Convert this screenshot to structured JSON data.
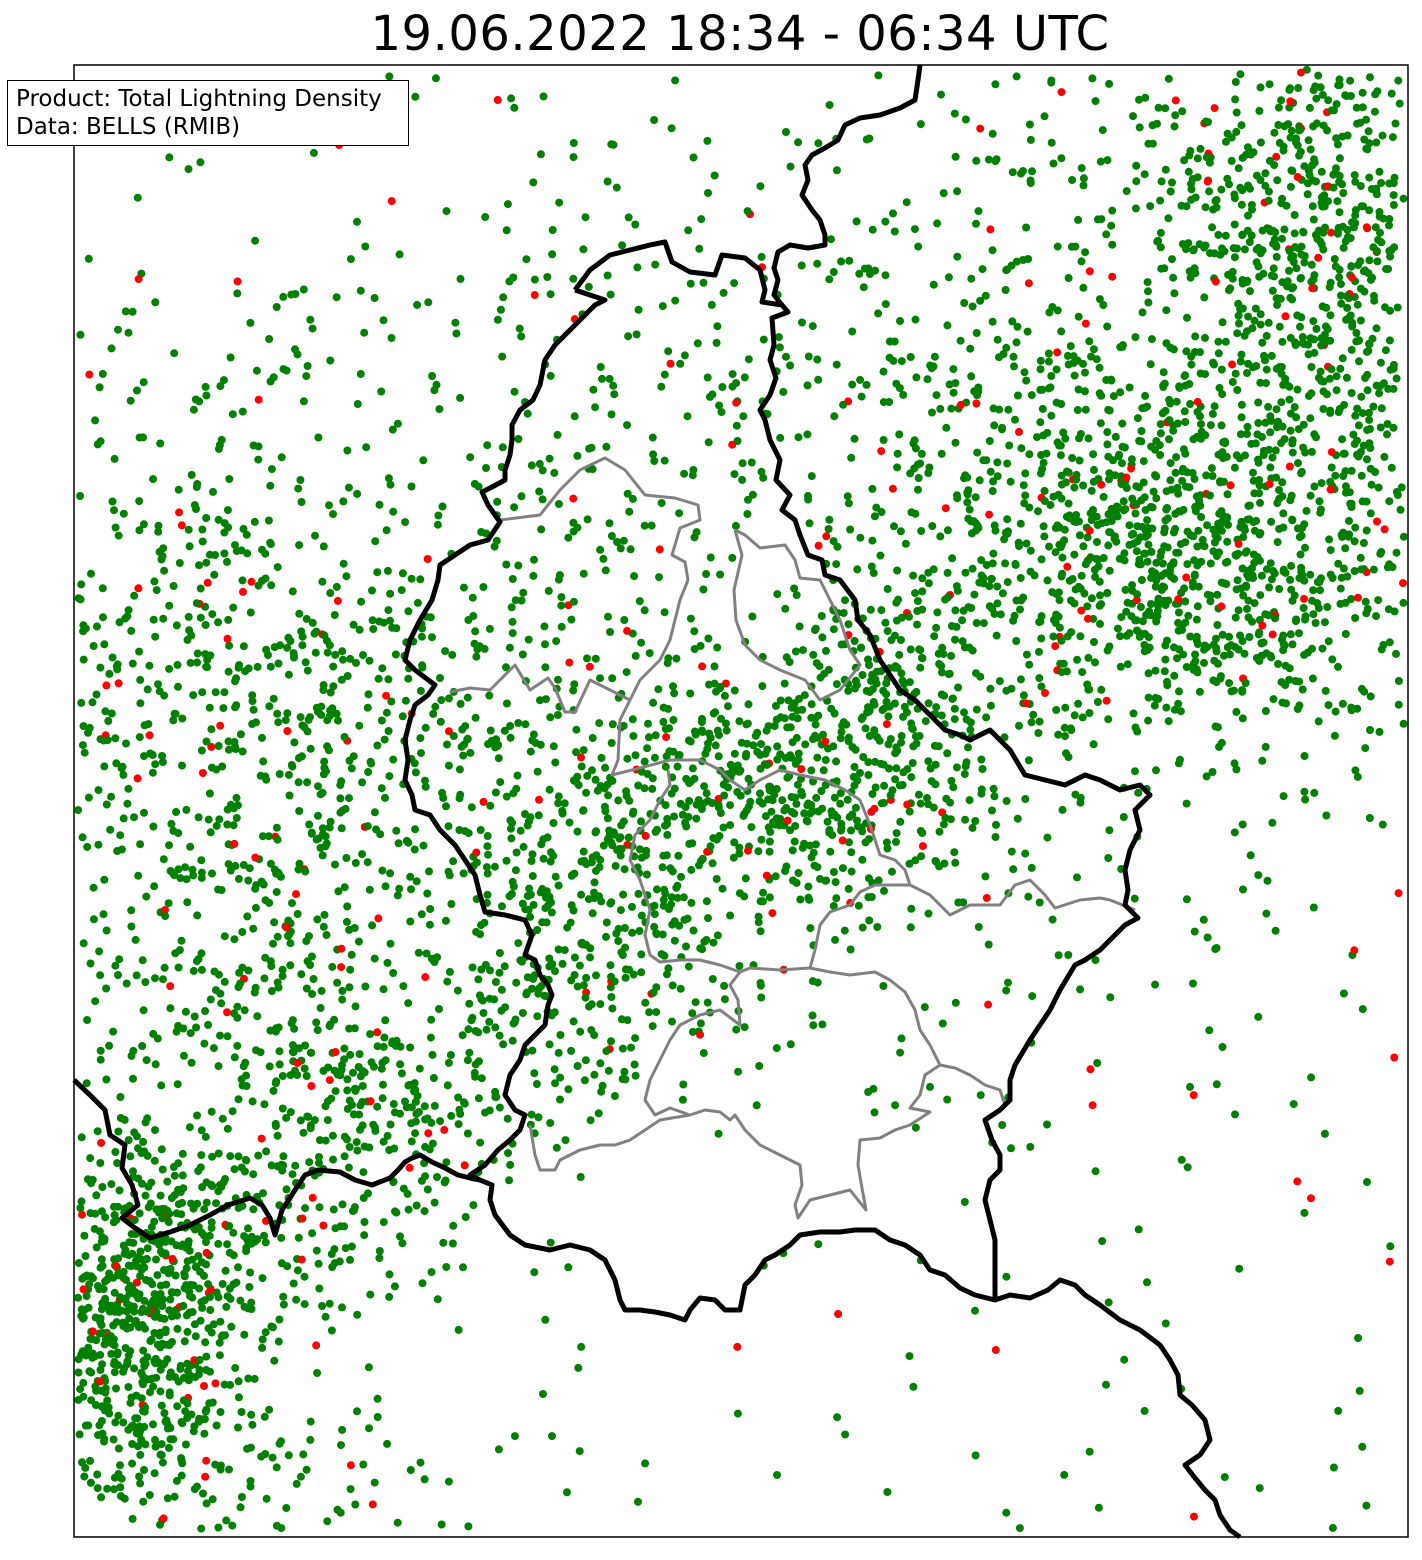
{
  "title": "19.06.2022 18:34 - 06:34 UTC",
  "info_box": {
    "product": "Product: Total Lightning Density",
    "data_source": "Data: BELLS (RMIB)"
  },
  "colors": {
    "cloud_to_ground_dot": "#008000",
    "highlight_dot": "#ff0000",
    "national_border": "#000000",
    "district_border": "#808080",
    "background": "#ffffff"
  },
  "legend_items": []
}
